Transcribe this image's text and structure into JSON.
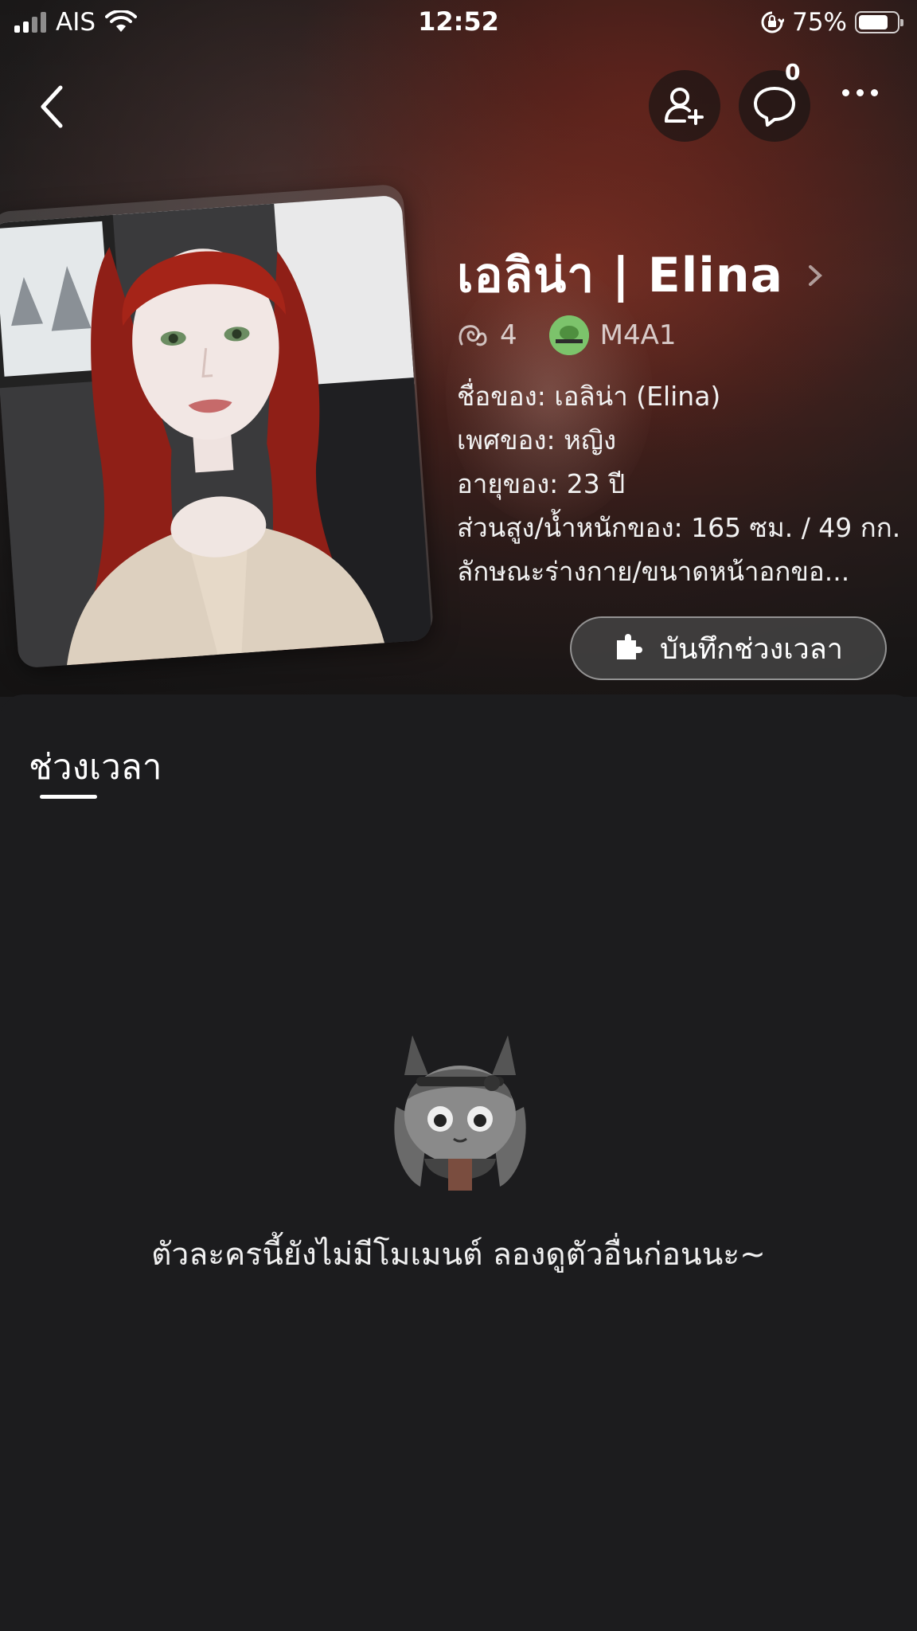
{
  "status_bar": {
    "carrier": "AIS",
    "time": "12:52",
    "battery_percent": "75%"
  },
  "header": {
    "message_count": "0"
  },
  "character": {
    "name": "เอลิน่า | Elina",
    "count": "4",
    "creator": "M4A1",
    "description_lines": [
      "ชื่อของ: เอลิน่า (Elina)",
      "เพศของ: หญิง",
      "อายุของ: 23 ปี",
      "ส่วนสูง/น้ำหนักของ: 165 ซม. / 49 กก.",
      "ลักษณะร่างกาย/ขนาดหน้าอกขอ..."
    ]
  },
  "record_button_label": "บันทึกช่วงเวลา",
  "tabs": {
    "moments": "ช่วงเวลา"
  },
  "empty_state": {
    "message": "ตัวละครนี้ยังไม่มีโมเมนต์ ลองดูตัวอื่นก่อนนะ~"
  },
  "colors": {
    "background": "#1c1c1e",
    "text": "#ffffff"
  }
}
